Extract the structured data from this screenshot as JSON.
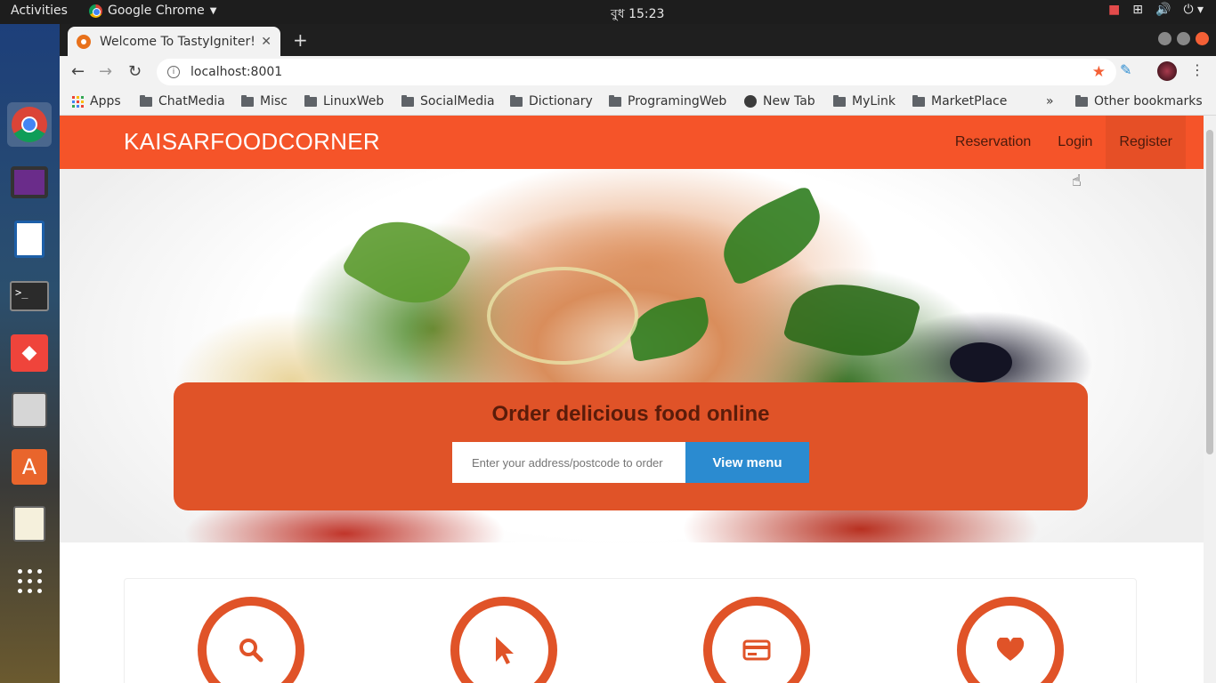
{
  "topbar": {
    "activities": "Activities",
    "app_name": "Google Chrome",
    "clock": "বুধ 15:23"
  },
  "browser": {
    "tab_title": "Welcome To TastyIgniter!",
    "url": "localhost:8001",
    "bookmarks": [
      {
        "label": "Apps",
        "icon": "apps-grid-icon"
      },
      {
        "label": "ChatMedia",
        "icon": "folder-icon"
      },
      {
        "label": "Misc",
        "icon": "folder-icon"
      },
      {
        "label": "LinuxWeb",
        "icon": "folder-icon"
      },
      {
        "label": "SocialMedia",
        "icon": "folder-icon"
      },
      {
        "label": "Dictionary",
        "icon": "folder-icon"
      },
      {
        "label": "ProgramingWeb",
        "icon": "folder-icon"
      },
      {
        "label": "New Tab",
        "icon": "globe-icon"
      },
      {
        "label": "MyLink",
        "icon": "folder-icon"
      },
      {
        "label": "MarketPlace",
        "icon": "folder-icon"
      }
    ],
    "overflow": "»",
    "other_bookmarks": "Other bookmarks"
  },
  "site": {
    "brand": "KAISARFOODCORNER",
    "nav": [
      "Reservation",
      "Login",
      "Register"
    ],
    "hero_title": "Order delicious food online",
    "address_placeholder": "Enter your address/postcode to order",
    "view_menu": "View menu",
    "accent": "#f55429"
  },
  "steps": [
    {
      "icon": "search-icon"
    },
    {
      "icon": "pointer-icon"
    },
    {
      "icon": "credit-card-icon"
    },
    {
      "icon": "heart-icon"
    }
  ]
}
